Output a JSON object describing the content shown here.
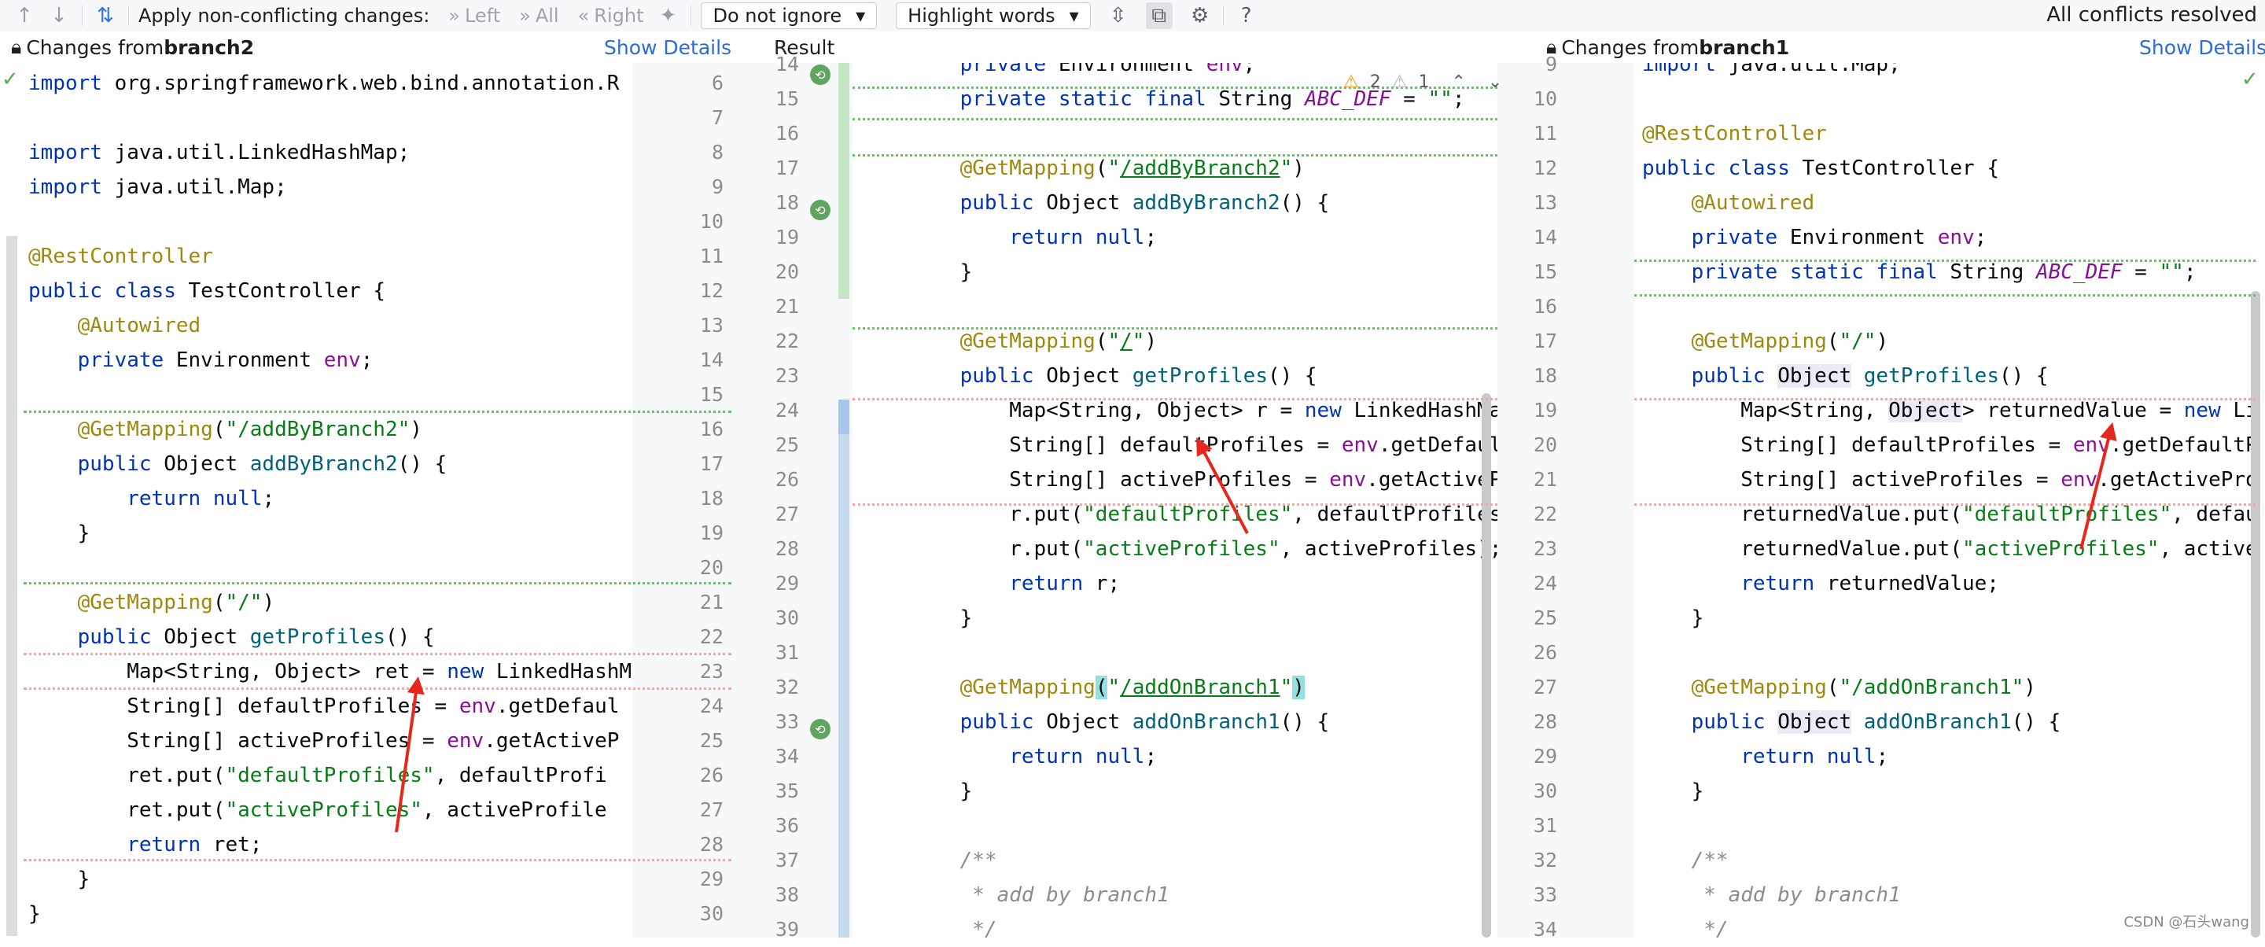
{
  "toolbar": {
    "apply_label": "Apply non-conflicting changes:",
    "left_label": "Left",
    "all_label": "All",
    "right_label": "Right",
    "ignore_select": "Do not ignore",
    "highlight_select": "Highlight words",
    "status": "All conflicts resolved"
  },
  "left_header": {
    "prefix": "Changes from ",
    "branch": "branch2",
    "details": "Show Details"
  },
  "result_header": {
    "title": "Result"
  },
  "right_header": {
    "prefix": "Changes from ",
    "branch": "branch1",
    "details": "Show Details"
  },
  "result_status": {
    "warnings": "2",
    "weak_warnings": "1"
  },
  "watermark": "CSDN @石头wang",
  "left_lines": [
    {
      "n": "6",
      "t": "import org.springframework.web.bind.annotation.R"
    },
    {
      "n": "7",
      "t": ""
    },
    {
      "n": "8",
      "t": "import java.util.LinkedHashMap;"
    },
    {
      "n": "9",
      "t": "import java.util.Map;"
    },
    {
      "n": "10",
      "t": ""
    },
    {
      "n": "11",
      "t": "@RestController"
    },
    {
      "n": "12",
      "t": "public class TestController {"
    },
    {
      "n": "13",
      "t": "    @Autowired"
    },
    {
      "n": "14",
      "t": "    private Environment env;"
    },
    {
      "n": "15",
      "t": ""
    },
    {
      "n": "16",
      "t": "    @GetMapping(\"/addByBranch2\")"
    },
    {
      "n": "17",
      "t": "    public Object addByBranch2() {"
    },
    {
      "n": "18",
      "t": "        return null;"
    },
    {
      "n": "19",
      "t": "    }"
    },
    {
      "n": "20",
      "t": ""
    },
    {
      "n": "21",
      "t": "    @GetMapping(\"/\")"
    },
    {
      "n": "22",
      "t": "    public Object getProfiles() {"
    },
    {
      "n": "23",
      "t": "        Map<String, Object> ret = new LinkedHashM"
    },
    {
      "n": "24",
      "t": "        String[] defaultProfiles = env.getDefaul"
    },
    {
      "n": "25",
      "t": "        String[] activeProfiles = env.getActiveP"
    },
    {
      "n": "26",
      "t": "        ret.put(\"defaultProfiles\", defaultProfi"
    },
    {
      "n": "27",
      "t": "        ret.put(\"activeProfiles\", activeProfile"
    },
    {
      "n": "28",
      "t": "        return ret;"
    },
    {
      "n": "29",
      "t": "    }"
    },
    {
      "n": "30",
      "t": "}"
    }
  ],
  "result_lines": [
    {
      "n": "14",
      "t": "    private Environment env;"
    },
    {
      "n": "15",
      "t": "    private static final String ABC_DEF = \"\";"
    },
    {
      "n": "16",
      "t": ""
    },
    {
      "n": "17",
      "t": "    @GetMapping(\"/addByBranch2\")"
    },
    {
      "n": "18",
      "t": "    public Object addByBranch2() {"
    },
    {
      "n": "19",
      "t": "        return null;"
    },
    {
      "n": "20",
      "t": "    }"
    },
    {
      "n": "21",
      "t": ""
    },
    {
      "n": "22",
      "t": "    @GetMapping(\"/\")"
    },
    {
      "n": "23",
      "t": "    public Object getProfiles() {"
    },
    {
      "n": "24",
      "t": "        Map<String, Object> r = new LinkedHashMap<>"
    },
    {
      "n": "25",
      "t": "        String[] defaultProfiles = env.getDefaultPr"
    },
    {
      "n": "26",
      "t": "        String[] activeProfiles = env.getActiveProf"
    },
    {
      "n": "27",
      "t": "        r.put(\"defaultProfiles\", defaultProfiles);"
    },
    {
      "n": "28",
      "t": "        r.put(\"activeProfiles\", activeProfiles);"
    },
    {
      "n": "29",
      "t": "        return r;"
    },
    {
      "n": "30",
      "t": "    }"
    },
    {
      "n": "31",
      "t": ""
    },
    {
      "n": "32",
      "t": "    @GetMapping(\"/addOnBranch1\")"
    },
    {
      "n": "33",
      "t": "    public Object addOnBranch1() {"
    },
    {
      "n": "34",
      "t": "        return null;"
    },
    {
      "n": "35",
      "t": "    }"
    },
    {
      "n": "36",
      "t": ""
    },
    {
      "n": "37",
      "t": "    /**"
    },
    {
      "n": "38",
      "t": "     * add by branch1"
    },
    {
      "n": "39",
      "t": "     */"
    }
  ],
  "right_lines": [
    {
      "n": "9",
      "t": "import java.util.Map;"
    },
    {
      "n": "10",
      "t": ""
    },
    {
      "n": "11",
      "t": "@RestController"
    },
    {
      "n": "12",
      "t": "public class TestController {"
    },
    {
      "n": "13",
      "t": "    @Autowired"
    },
    {
      "n": "14",
      "t": "    private Environment env;"
    },
    {
      "n": "15",
      "t": "    private static final String ABC_DEF = \"\";"
    },
    {
      "n": "16",
      "t": ""
    },
    {
      "n": "17",
      "t": "    @GetMapping(\"/\")"
    },
    {
      "n": "18",
      "t": "    public Object getProfiles() {"
    },
    {
      "n": "19",
      "t": "        Map<String, Object> returnedValue = new Li"
    },
    {
      "n": "20",
      "t": "        String[] defaultProfiles = env.getDefaultP"
    },
    {
      "n": "21",
      "t": "        String[] activeProfiles = env.getActivePro"
    },
    {
      "n": "22",
      "t": "        returnedValue.put(\"defaultProfiles\", defau"
    },
    {
      "n": "23",
      "t": "        returnedValue.put(\"activeProfiles\", active"
    },
    {
      "n": "24",
      "t": "        return returnedValue;"
    },
    {
      "n": "25",
      "t": "    }"
    },
    {
      "n": "26",
      "t": ""
    },
    {
      "n": "27",
      "t": "    @GetMapping(\"/addOnBranch1\")"
    },
    {
      "n": "28",
      "t": "    public Object addOnBranch1() {"
    },
    {
      "n": "29",
      "t": "        return null;"
    },
    {
      "n": "30",
      "t": "    }"
    },
    {
      "n": "31",
      "t": ""
    },
    {
      "n": "32",
      "t": "    /**"
    },
    {
      "n": "33",
      "t": "     * add by branch1"
    },
    {
      "n": "34",
      "t": "     */"
    }
  ]
}
